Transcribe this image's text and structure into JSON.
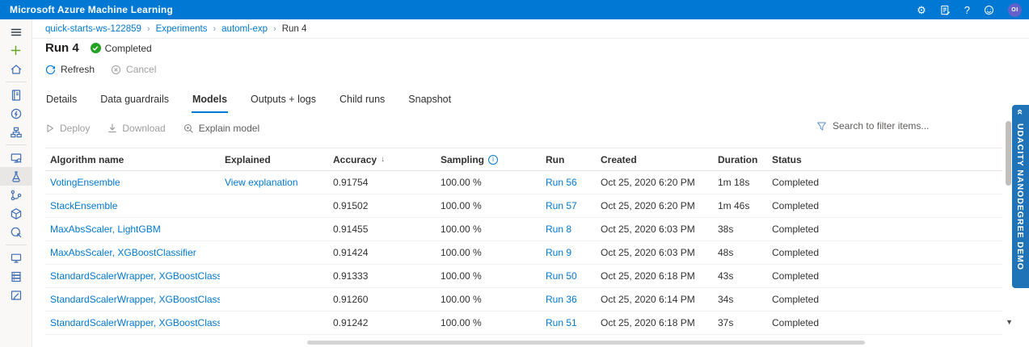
{
  "topbar": {
    "title": "Microsoft Azure Machine Learning",
    "user_initials": "OI"
  },
  "icons": {
    "gear": "⚙",
    "help": "?",
    "breadcrumb_separator": "›",
    "sort_desc": "↓",
    "info": "i",
    "collapse_chevron": "«",
    "scroll_down_arrow": "▼"
  },
  "breadcrumb": {
    "items": [
      {
        "label": "quick-starts-ws-122859"
      },
      {
        "label": "Experiments"
      },
      {
        "label": "automl-exp"
      },
      {
        "label": "Run 4"
      }
    ]
  },
  "sidebar": {
    "selected": "experiments",
    "items": [
      "menu",
      "new",
      "home",
      "notebooks",
      "automated-ml",
      "designer",
      "datasets",
      "experiments",
      "pipelines",
      "models",
      "endpoints",
      "compute",
      "datastores",
      "data-labeling"
    ]
  },
  "run_header": {
    "title": "Run 4",
    "status": "Completed"
  },
  "commands": {
    "refresh": "Refresh",
    "cancel": "Cancel"
  },
  "tabs": {
    "selected": "Models",
    "items": [
      "Details",
      "Data guardrails",
      "Models",
      "Outputs + logs",
      "Child runs",
      "Snapshot"
    ]
  },
  "toolbar": {
    "deploy": "Deploy",
    "download": "Download",
    "explain": "Explain model",
    "search_placeholder": "Search to filter items..."
  },
  "table": {
    "columns": [
      "Algorithm name",
      "Explained",
      "Accuracy",
      "Sampling",
      "Run",
      "Created",
      "Duration",
      "Status"
    ],
    "sort_column": "Accuracy",
    "sort_direction": "desc",
    "rows": [
      {
        "algorithm": "VotingEnsemble",
        "explained": "View explanation",
        "accuracy": "0.91754",
        "sampling": "100.00 %",
        "run": "Run 56",
        "created": "Oct 25, 2020 6:20 PM",
        "duration": "1m 18s",
        "status": "Completed"
      },
      {
        "algorithm": "StackEnsemble",
        "explained": "",
        "accuracy": "0.91502",
        "sampling": "100.00 %",
        "run": "Run 57",
        "created": "Oct 25, 2020 6:20 PM",
        "duration": "1m 46s",
        "status": "Completed"
      },
      {
        "algorithm": "MaxAbsScaler, LightGBM",
        "explained": "",
        "accuracy": "0.91455",
        "sampling": "100.00 %",
        "run": "Run 8",
        "created": "Oct 25, 2020 6:03 PM",
        "duration": "38s",
        "status": "Completed"
      },
      {
        "algorithm": "MaxAbsScaler, XGBoostClassifier",
        "explained": "",
        "accuracy": "0.91424",
        "sampling": "100.00 %",
        "run": "Run 9",
        "created": "Oct 25, 2020 6:03 PM",
        "duration": "48s",
        "status": "Completed"
      },
      {
        "algorithm": "StandardScalerWrapper, XGBoostClassifier",
        "explained": "",
        "accuracy": "0.91333",
        "sampling": "100.00 %",
        "run": "Run 50",
        "created": "Oct 25, 2020 6:18 PM",
        "duration": "43s",
        "status": "Completed"
      },
      {
        "algorithm": "StandardScalerWrapper, XGBoostClassifier",
        "explained": "",
        "accuracy": "0.91260",
        "sampling": "100.00 %",
        "run": "Run 36",
        "created": "Oct 25, 2020 6:14 PM",
        "duration": "34s",
        "status": "Completed"
      },
      {
        "algorithm": "StandardScalerWrapper, XGBoostClassifier",
        "explained": "",
        "accuracy": "0.91242",
        "sampling": "100.00 %",
        "run": "Run 51",
        "created": "Oct 25, 2020 6:18 PM",
        "duration": "37s",
        "status": "Completed"
      }
    ]
  },
  "banner": {
    "text": "UDACITY NANODEGREE DEMO"
  },
  "colors": {
    "accent": "#0078d4",
    "topbar_blue": "#0078d4",
    "status_green": "#23a123",
    "banner_blue": "#2173b8",
    "avatar_purple": "#6262c8",
    "link": "#0078d4"
  }
}
